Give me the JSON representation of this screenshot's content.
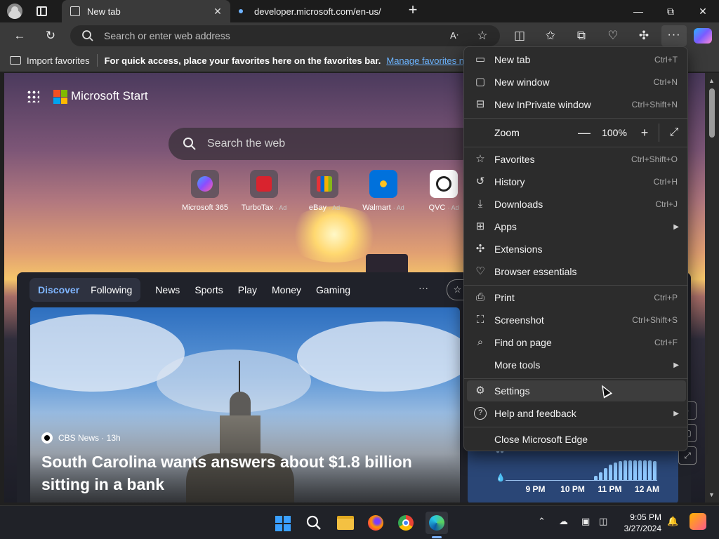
{
  "browser": {
    "tabs": [
      {
        "label": "New tab",
        "active": true
      },
      {
        "label": "developer.microsoft.com/en-us/",
        "active": false
      }
    ],
    "window_controls": {
      "minimize": "—",
      "restore": "⧉",
      "close": "✕"
    },
    "address_placeholder": "Search or enter web address",
    "favorites_bar": {
      "import_label": "Import favorites",
      "hint": "For quick access, place your favorites here on the favorites bar.",
      "manage_link": "Manage favorites now"
    }
  },
  "new_tab_page": {
    "brand": "Microsoft Start",
    "search_placeholder": "Search the web",
    "quick_links": [
      {
        "label": "Microsoft 365",
        "ad": "",
        "color": "#7b5cff"
      },
      {
        "label": "TurboTax",
        "ad": "· Ad",
        "color": "#d9232e"
      },
      {
        "label": "eBay",
        "ad": "· Ad",
        "color": "#1a73e8"
      },
      {
        "label": "Walmart",
        "ad": "· Ad",
        "color": "#0071dc"
      },
      {
        "label": "QVC",
        "ad": "· Ad",
        "color": "#ffffff"
      }
    ],
    "feed_nav": {
      "discover": "Discover",
      "following": "Following",
      "items": [
        "News",
        "Sports",
        "Play",
        "Money",
        "Gaming"
      ],
      "more": "···"
    },
    "hero": {
      "source": "CBS News · 13h",
      "headline": "South Carolina wants answers about $1.8 billion sitting in a bank"
    },
    "weather": {
      "time_labels": [
        "9 PM",
        "10 PM",
        "11 PM",
        "12 AM"
      ],
      "precip_levels": [
        0.2,
        0.4,
        0.6,
        0.8,
        0.9,
        0.95,
        1.0,
        1.0,
        1.0,
        1.0,
        1.0,
        1.0,
        0.95
      ]
    }
  },
  "menu": {
    "group1": [
      {
        "label": "New tab",
        "shortcut": "Ctrl+T",
        "icon": "new-tab-icon",
        "glyph": "▭"
      },
      {
        "label": "New window",
        "shortcut": "Ctrl+N",
        "icon": "window-icon",
        "glyph": "▢"
      },
      {
        "label": "New InPrivate window",
        "shortcut": "Ctrl+Shift+N",
        "icon": "inprivate-icon",
        "glyph": "⊟"
      }
    ],
    "zoom": {
      "label": "Zoom",
      "minus": "—",
      "value": "100%",
      "plus": "+",
      "fullscreen": "⤢"
    },
    "group2": [
      {
        "label": "Favorites",
        "shortcut": "Ctrl+Shift+O",
        "icon": "favorites-icon",
        "glyph": "☆"
      },
      {
        "label": "History",
        "shortcut": "Ctrl+H",
        "icon": "history-icon",
        "glyph": "↺"
      },
      {
        "label": "Downloads",
        "shortcut": "Ctrl+J",
        "icon": "download-icon",
        "glyph": "⤓"
      },
      {
        "label": "Apps",
        "shortcut": "",
        "icon": "apps-icon",
        "glyph": "⊞",
        "submenu": true
      },
      {
        "label": "Extensions",
        "shortcut": "",
        "icon": "extensions-icon",
        "glyph": "✣"
      },
      {
        "label": "Browser essentials",
        "shortcut": "",
        "icon": "heart-pulse-icon",
        "glyph": "♡"
      }
    ],
    "group3": [
      {
        "label": "Print",
        "shortcut": "Ctrl+P",
        "icon": "print-icon",
        "glyph": "⎙"
      },
      {
        "label": "Screenshot",
        "shortcut": "Ctrl+Shift+S",
        "icon": "screenshot-icon",
        "glyph": "⛶"
      },
      {
        "label": "Find on page",
        "shortcut": "Ctrl+F",
        "icon": "find-icon",
        "glyph": "⌕"
      },
      {
        "label": "More tools",
        "shortcut": "",
        "icon": "",
        "glyph": "",
        "submenu": true
      }
    ],
    "group4": [
      {
        "label": "Settings",
        "shortcut": "",
        "icon": "gear-icon",
        "glyph": "⚙",
        "hover": true
      },
      {
        "label": "Help and feedback",
        "shortcut": "",
        "icon": "help-icon",
        "glyph": "?",
        "submenu": true
      }
    ],
    "close_label": "Close Microsoft Edge"
  },
  "taskbar": {
    "time": "9:05 PM",
    "date": "3/27/2024"
  },
  "colors": {
    "accent": "#7fb5ff",
    "link": "#6cb4ff",
    "menu_bg": "#2c2c2c"
  }
}
